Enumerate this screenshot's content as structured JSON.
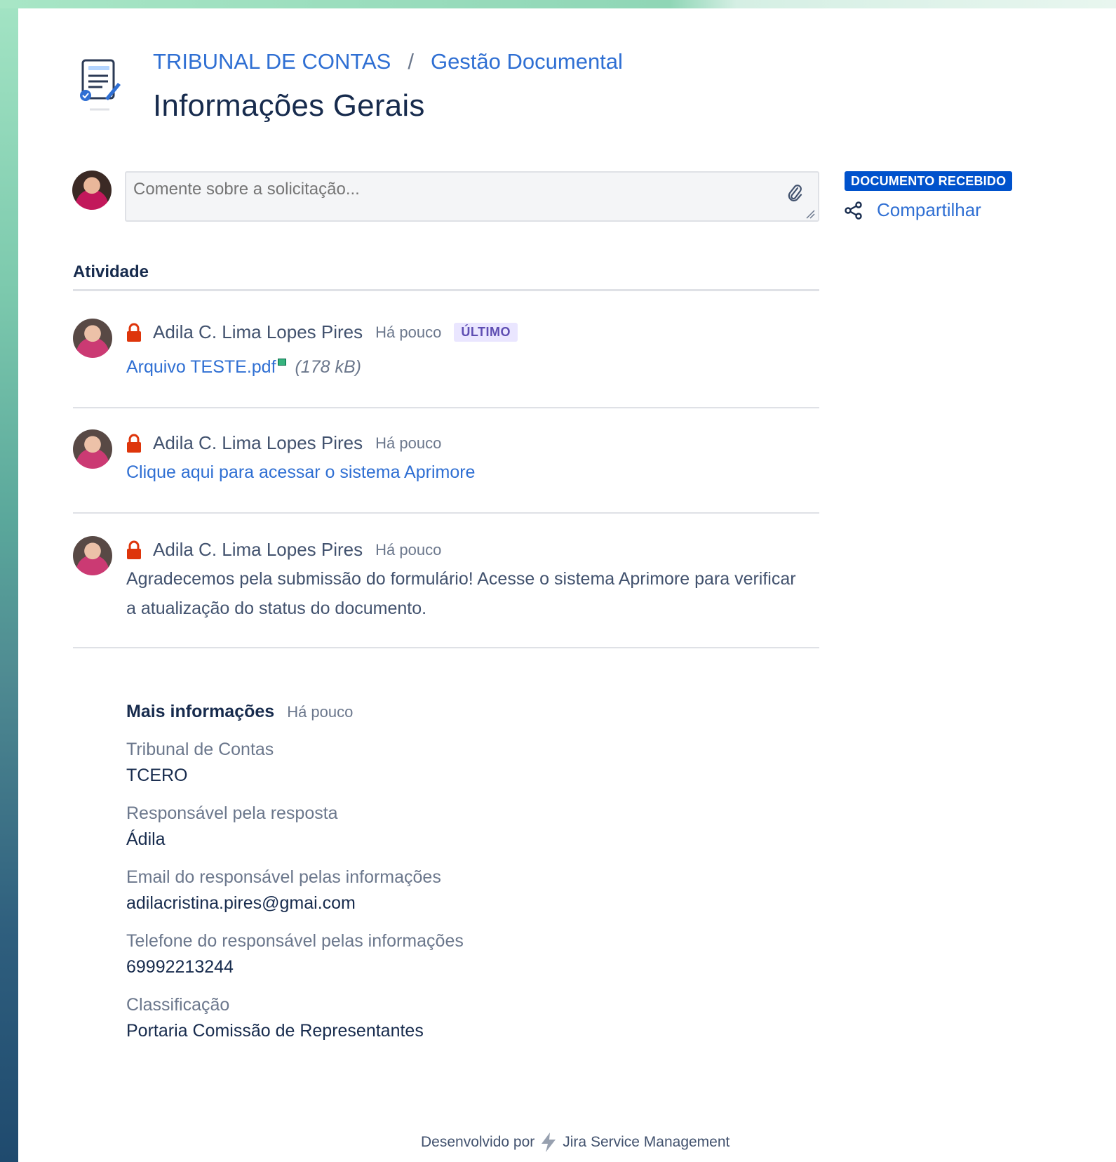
{
  "breadcrumb": {
    "org": "TRIBUNAL DE CONTAS",
    "separator": "/",
    "portal": "Gestão Documental"
  },
  "page_title": "Informações Gerais",
  "comment": {
    "placeholder": "Comente sobre a solicitação..."
  },
  "sidebar": {
    "status": "DOCUMENTO RECEBIDO",
    "share_label": "Compartilhar"
  },
  "activity": {
    "title": "Atividade",
    "items": [
      {
        "author": "Adila C. Lima Lopes Pires",
        "time": "Há pouco",
        "badge": "ÚLTIMO",
        "file_name": "Arquivo TESTE.pdf",
        "file_size": "(178 kB)"
      },
      {
        "author": "Adila C. Lima Lopes Pires",
        "time": "Há pouco",
        "link_text": "Clique aqui para acessar o sistema Aprimore"
      },
      {
        "author": "Adila C. Lima Lopes Pires",
        "time": "Há pouco",
        "text_line1": "Agradecemos pela submissão do formulário! Acesse o sistema Aprimore para verificar",
        "text_line2": "a atualização do status do documento."
      }
    ]
  },
  "more_info": {
    "title": "Mais informações",
    "time": "Há pouco",
    "fields": [
      {
        "label": "Tribunal de Contas",
        "value": "TCERO"
      },
      {
        "label": "Responsável pela resposta",
        "value": "Ádila"
      },
      {
        "label": "Email do responsável pelas informações",
        "value": "adilacristina.pires@gmai.com"
      },
      {
        "label": "Telefone do responsável pelas informações",
        "value": "69992213244"
      },
      {
        "label": "Classificação",
        "value": "Portaria Comissão de Representantes"
      }
    ]
  },
  "footer": {
    "prefix": "Desenvolvido por",
    "product": "Jira Service Management"
  },
  "colors": {
    "link": "#2f6fd3",
    "status_badge": "#0052cc",
    "lock": "#de350b",
    "latest_badge_bg": "#eae6ff"
  }
}
